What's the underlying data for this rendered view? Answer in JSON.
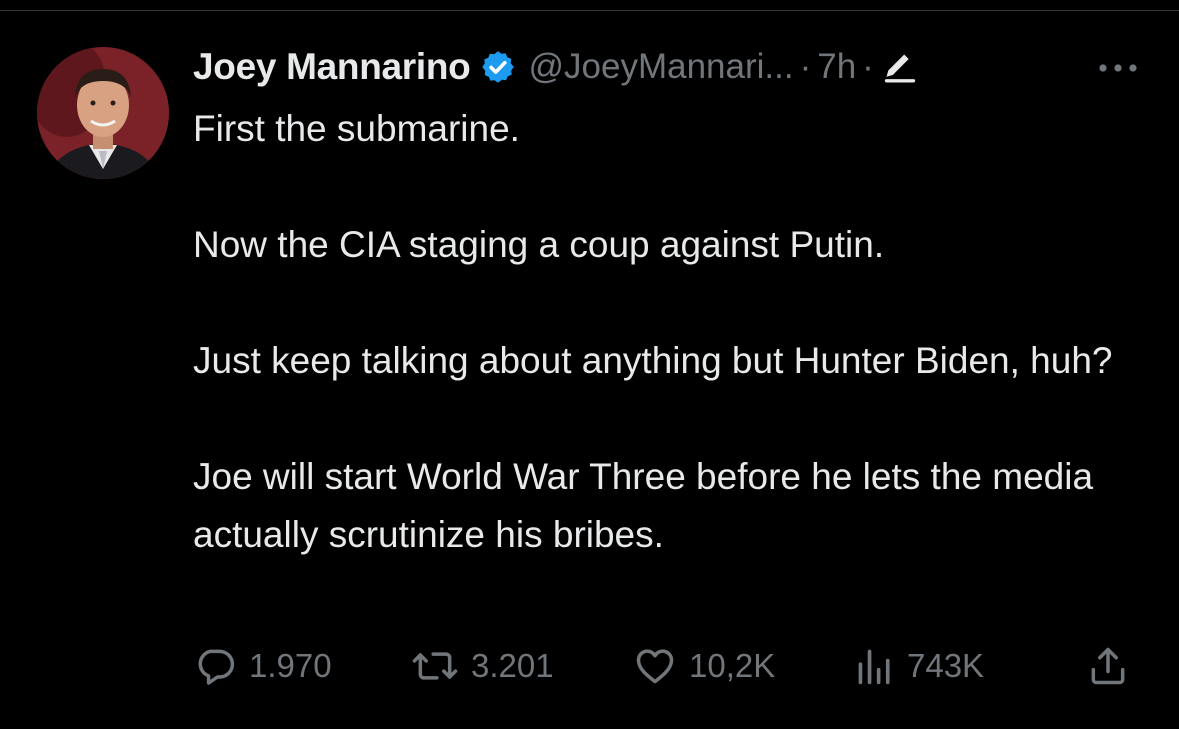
{
  "tweet": {
    "author": {
      "display_name": "Joey Mannarino",
      "handle": "@JoeyMannari...",
      "verified": true
    },
    "time": "7h",
    "separator": "·",
    "edited": true,
    "paragraphs": [
      "First the submarine.",
      "Now the CIA staging a coup against Putin.",
      "Just keep talking about anything but Hunter Biden, huh?",
      "Joe will start World War Three before he lets the media actually scrutinize his bribes."
    ],
    "stats": {
      "replies": "1.970",
      "retweets": "3.201",
      "likes": "10,2K",
      "views": "743K"
    }
  },
  "colors": {
    "background": "#000000",
    "text": "#e7e9ea",
    "muted": "#71767b",
    "verified_badge": "#1d9bf0"
  },
  "icons": [
    "verified-badge-icon",
    "edit-pencil-icon",
    "more-options-icon",
    "reply-icon",
    "retweet-icon",
    "like-heart-icon",
    "views-chart-icon",
    "share-icon"
  ]
}
